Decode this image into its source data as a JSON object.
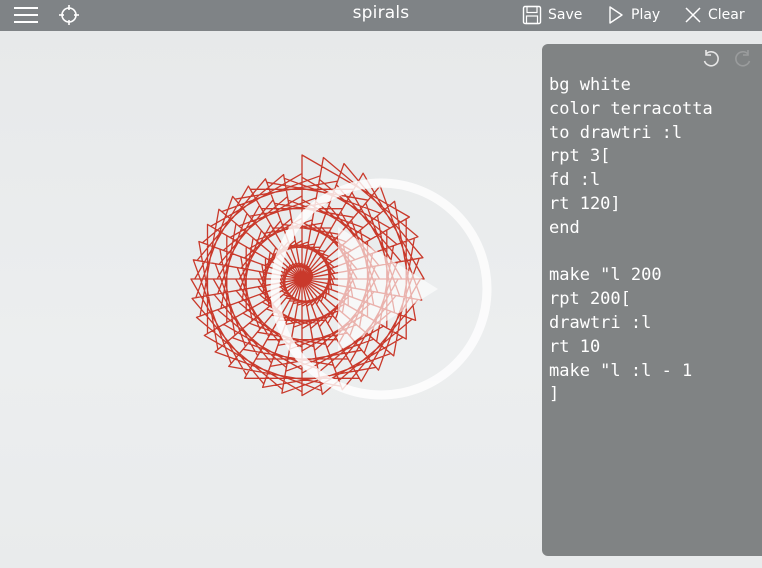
{
  "app": {
    "title": "spirals"
  },
  "toolbar": {
    "menu_icon": "hamburger-icon",
    "center_icon": "crosshair-icon",
    "save_label": "Save",
    "play_label": "Play",
    "clear_label": "Clear"
  },
  "editor": {
    "undo_icon": "undo-icon",
    "redo_icon": "redo-icon",
    "code_lines": [
      "bg white",
      "color terracotta",
      "to drawtri :l",
      "rpt 3[",
      "fd :l",
      "rt 120]",
      "end",
      "",
      "make \"l 200",
      "rpt 200[",
      "drawtri :l",
      "rt 10",
      "make \"l :l - 1",
      "]"
    ]
  },
  "drawing": {
    "stroke_color": "#c9392b",
    "background": "white",
    "play_overlay_icon": "play-overlay-icon"
  }
}
